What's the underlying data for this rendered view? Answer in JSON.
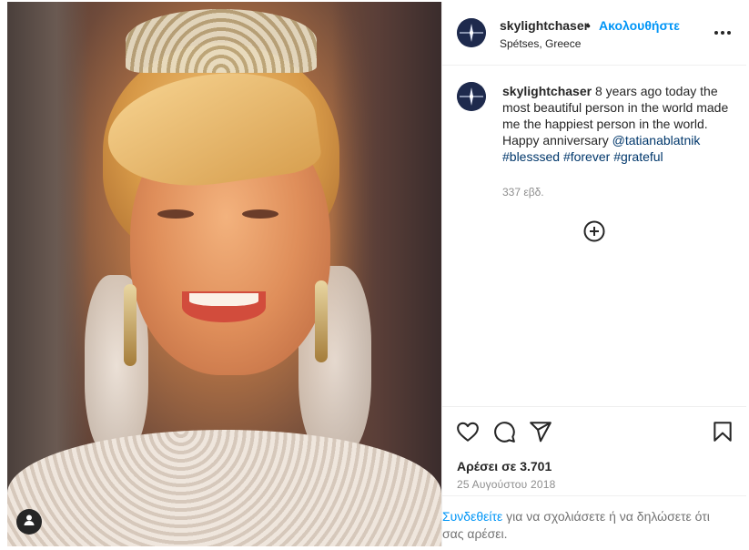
{
  "post": {
    "username": "skylightchaser",
    "separator": "•",
    "follow_label": "Ακολουθήστε",
    "location": "Spétses, Greece",
    "more_icon": "more-horizontal-icon"
  },
  "caption": {
    "username": "skylightchaser",
    "text_main": " 8 years ago today the most beautiful person in the world made me the happiest person in the world.",
    "text_anniv": "Happy anniversary ",
    "mention": "@tatianablatnik",
    "hashtags": [
      "#blesssed",
      "#forever",
      "#grateful"
    ],
    "time_ago": "337 εβδ."
  },
  "actions": {
    "icons": [
      "heart-icon",
      "comment-icon",
      "share-icon",
      "bookmark-icon"
    ],
    "likes_label": "Αρέσει σε 3.701",
    "date": "25 Αυγούστου 2018"
  },
  "comment": {
    "login_link": "Συνδεθείτε",
    "rest": " για να σχολιάσετε ή να δηλώσετε ότι σας αρέσει."
  },
  "colors": {
    "accent": "#0095f6",
    "link": "#00376b",
    "text": "#262626",
    "muted": "#8e8e8e"
  }
}
